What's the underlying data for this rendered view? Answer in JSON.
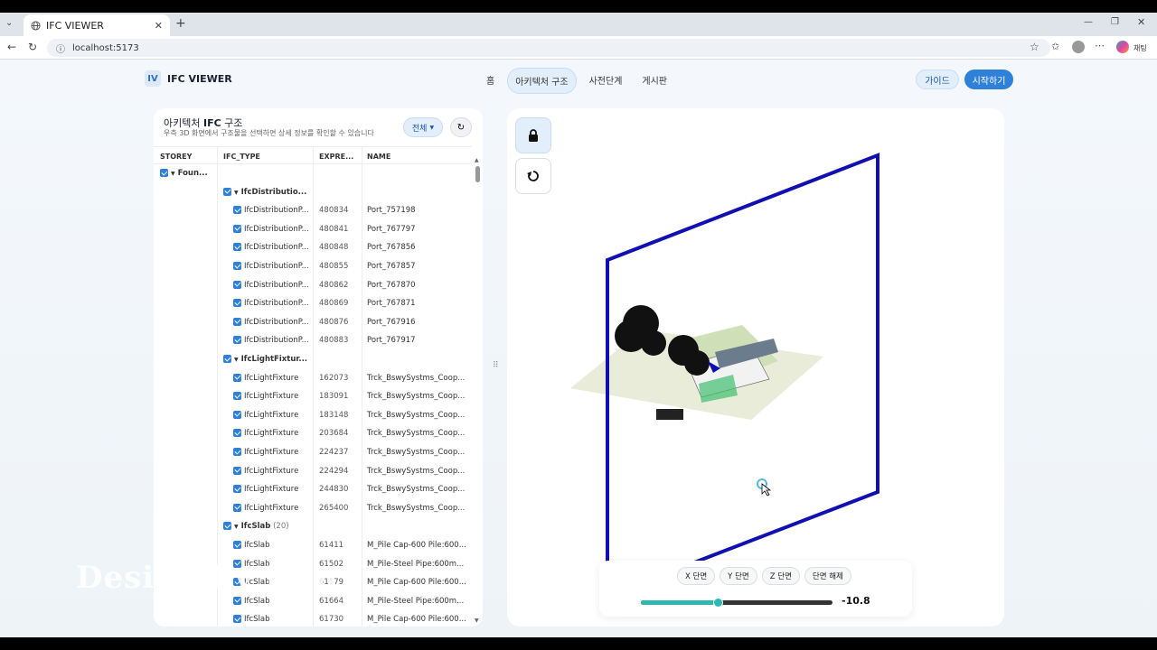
{
  "browser": {
    "tab_title": "IFC VIEWER",
    "url": "localhost:5173",
    "profile_label": "채팅"
  },
  "header": {
    "logo_badge": "IV",
    "logo_text": "IFC VIEWER",
    "nav": [
      {
        "label": "홈"
      },
      {
        "label": "아키텍처 구조"
      },
      {
        "label": "사전단계"
      },
      {
        "label": "게시판"
      }
    ],
    "guide_label": "가이드",
    "start_label": "시작하기"
  },
  "panel": {
    "title_prefix": "아키텍처 ",
    "title_bold": "IFC",
    "title_suffix": " 구조",
    "subtitle": "우측 3D 화면에서 구조물을 선택하면 상세 정보를 확인할 수 있습니다",
    "filter_label": "전체",
    "columns": [
      "STOREY",
      "IFC_TYPE",
      "EXPRE...",
      "NAME"
    ],
    "rows": [
      {
        "kind": "storey",
        "label": "Foun..."
      },
      {
        "kind": "group",
        "label": "IfcDistributio..."
      },
      {
        "kind": "item",
        "type": "IfcDistributionP...",
        "expr": "480834",
        "name": "Port_757198"
      },
      {
        "kind": "item",
        "type": "IfcDistributionP...",
        "expr": "480841",
        "name": "Port_767797"
      },
      {
        "kind": "item",
        "type": "IfcDistributionP...",
        "expr": "480848",
        "name": "Port_767856"
      },
      {
        "kind": "item",
        "type": "IfcDistributionP...",
        "expr": "480855",
        "name": "Port_767857"
      },
      {
        "kind": "item",
        "type": "IfcDistributionP...",
        "expr": "480862",
        "name": "Port_767870"
      },
      {
        "kind": "item",
        "type": "IfcDistributionP...",
        "expr": "480869",
        "name": "Port_767871"
      },
      {
        "kind": "item",
        "type": "IfcDistributionP...",
        "expr": "480876",
        "name": "Port_767916"
      },
      {
        "kind": "item",
        "type": "IfcDistributionP...",
        "expr": "480883",
        "name": "Port_767917"
      },
      {
        "kind": "group",
        "label": "IfcLightFixtur..."
      },
      {
        "kind": "item",
        "type": "IfcLightFixture",
        "expr": "162073",
        "name": "Trck_BswySystms_Coop..."
      },
      {
        "kind": "item",
        "type": "IfcLightFixture",
        "expr": "183091",
        "name": "Trck_BswySystms_Coop..."
      },
      {
        "kind": "item",
        "type": "IfcLightFixture",
        "expr": "183148",
        "name": "Trck_BswySystms_Coop..."
      },
      {
        "kind": "item",
        "type": "IfcLightFixture",
        "expr": "203684",
        "name": "Trck_BswySystms_Coop..."
      },
      {
        "kind": "item",
        "type": "IfcLightFixture",
        "expr": "224237",
        "name": "Trck_BswySystms_Coop..."
      },
      {
        "kind": "item",
        "type": "IfcLightFixture",
        "expr": "224294",
        "name": "Trck_BswySystms_Coop..."
      },
      {
        "kind": "item",
        "type": "IfcLightFixture",
        "expr": "244830",
        "name": "Trck_BswySystms_Coop..."
      },
      {
        "kind": "item",
        "type": "IfcLightFixture",
        "expr": "265400",
        "name": "Trck_BswySystms_Coop..."
      },
      {
        "kind": "group",
        "label": "IfcSlab",
        "count": "(20)"
      },
      {
        "kind": "item",
        "type": "IfcSlab",
        "expr": "61411",
        "name": "M_Pile Cap-600 Pile:600..."
      },
      {
        "kind": "item",
        "type": "IfcSlab",
        "expr": "61502",
        "name": "M_Pile-Steel Pipe:600m..."
      },
      {
        "kind": "item",
        "type": "IfcSlab",
        "expr": "61579",
        "name": "M_Pile Cap-600 Pile:600..."
      },
      {
        "kind": "item",
        "type": "IfcSlab",
        "expr": "61664",
        "name": "M_Pile-Steel Pipe:600m..."
      },
      {
        "kind": "item",
        "type": "IfcSlab",
        "expr": "61730",
        "name": "M_Pile Cap-600 Pile:600..."
      }
    ]
  },
  "viewer": {
    "section_buttons": [
      "X 단면",
      "Y 단면",
      "Z 단면",
      "단면 해제"
    ],
    "slider_value": "-10.8",
    "slider_fraction": 0.4
  },
  "watermark": "Design by Kbu",
  "colors": {
    "accent": "#2f80d8",
    "section_plane": "#1010b0",
    "slider": "#2fb8b0"
  }
}
